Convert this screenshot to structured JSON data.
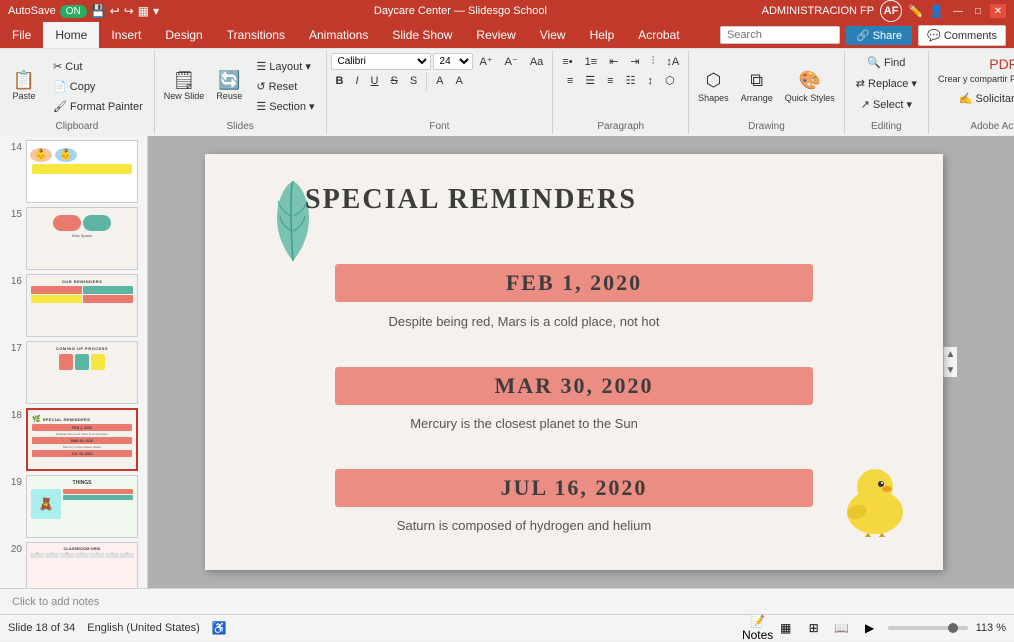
{
  "titleBar": {
    "autosave": "AutoSave",
    "toggle": "ON",
    "title": "Daycare Center — Slidesgo School",
    "user": "ADMINISTRACION FP",
    "windowControls": {
      "minimize": "—",
      "maximize": "□",
      "close": "✕"
    }
  },
  "ribbon": {
    "tabs": [
      "File",
      "Home",
      "Insert",
      "Design",
      "Transitions",
      "Animations",
      "Slide Show",
      "Review",
      "View",
      "Help",
      "Acrobat"
    ],
    "activeTab": "Home",
    "groups": {
      "clipboard": {
        "label": "Clipboard",
        "buttons": [
          "Paste",
          "Cut",
          "Copy",
          "Format Painter"
        ]
      },
      "slides": {
        "label": "Slides",
        "buttons": [
          "New Slide",
          "Layout",
          "Reset",
          "Section"
        ]
      },
      "font": {
        "label": "Font",
        "fontName": "Calibri",
        "fontSize": "24",
        "buttons": [
          "B",
          "I",
          "U",
          "S",
          "A",
          "A",
          "A"
        ],
        "label2": "Font"
      },
      "paragraph": {
        "label": "Paragraph"
      },
      "drawing": {
        "label": "Drawing",
        "buttons": [
          "Shapes",
          "Arrange",
          "Quick Styles"
        ]
      },
      "editing": {
        "label": "Editing",
        "buttons": [
          "Find",
          "Replace",
          "Select"
        ]
      }
    },
    "rightButtons": {
      "share": "Share",
      "comments": "Comments"
    },
    "searchPlaceholder": "Search"
  },
  "slides": [
    {
      "num": "14",
      "active": false,
      "type": "kids"
    },
    {
      "num": "15",
      "active": false,
      "type": "kids2"
    },
    {
      "num": "16",
      "active": false,
      "type": "reminders-grid"
    },
    {
      "num": "17",
      "active": false,
      "type": "coming-soon"
    },
    {
      "num": "18",
      "active": true,
      "type": "special-reminders"
    },
    {
      "num": "19",
      "active": false,
      "type": "blocks"
    },
    {
      "num": "20",
      "active": false,
      "type": "calendar"
    }
  ],
  "mainSlide": {
    "decoration": "🌿",
    "title": "SPECIAL REMINDERS",
    "items": [
      {
        "date": "FEB 1, 2020",
        "description": "Despite being red, Mars is a cold place, not hot"
      },
      {
        "date": "MAR 30, 2020",
        "description": "Mercury is the closest planet to the Sun"
      },
      {
        "date": "JUL 16, 2020",
        "description": "Saturn is composed of hydrogen and helium"
      }
    ],
    "decoration2": "🐥"
  },
  "statusBar": {
    "slideInfo": "Slide 18 of 34",
    "language": "English (United States)",
    "notesLabel": "Click to add notes",
    "viewButtons": [
      "Notes",
      "⊞",
      "⊟",
      "📊"
    ],
    "zoom": "113 %"
  }
}
